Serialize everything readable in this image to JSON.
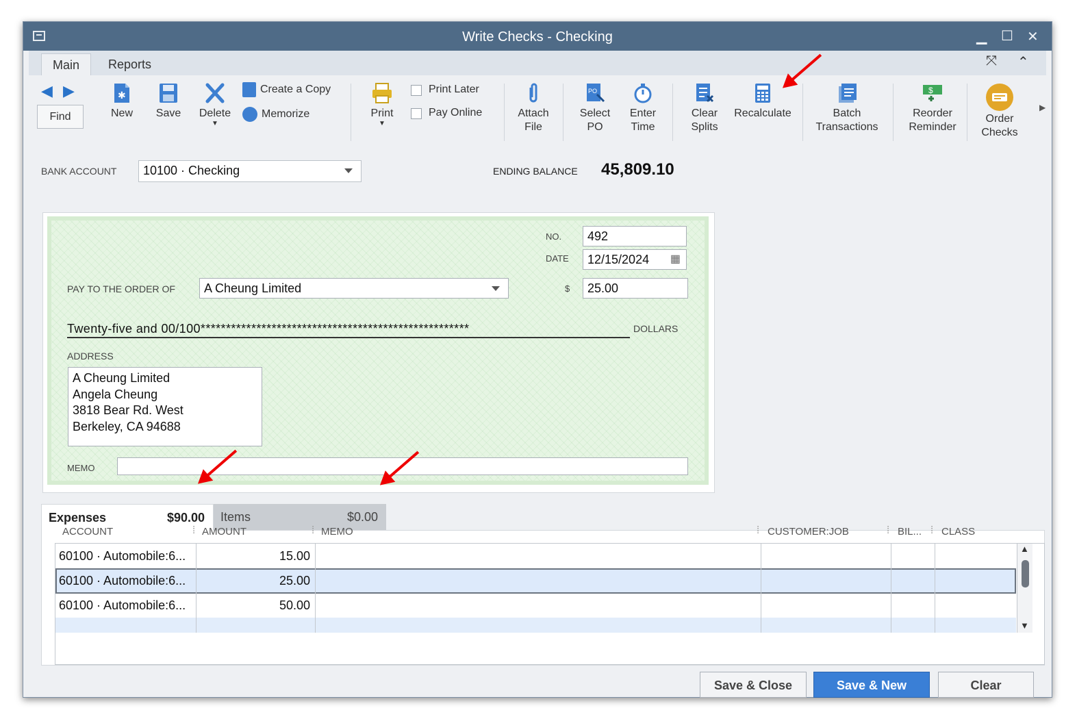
{
  "window": {
    "title": "Write Checks - Checking"
  },
  "tabs": [
    {
      "label": "Main"
    },
    {
      "label": "Reports"
    }
  ],
  "toolbar": {
    "find": "Find",
    "new": "New",
    "save": "Save",
    "delete": "Delete",
    "create_copy": "Create a Copy",
    "memorize": "Memorize",
    "print": "Print",
    "print_later": "Print Later",
    "pay_online": "Pay Online",
    "attach_1": "Attach",
    "attach_2": "File",
    "select_1": "Select",
    "select_2": "PO",
    "enter_1": "Enter",
    "enter_2": "Time",
    "clear_1": "Clear",
    "clear_2": "Splits",
    "recalculate": "Recalculate",
    "batch_1": "Batch",
    "batch_2": "Transactions",
    "reorder_1": "Reorder",
    "reorder_2": "Reminder",
    "order_1": "Order",
    "order_2": "Checks"
  },
  "bank": {
    "label": "BANK ACCOUNT",
    "value": "10100 · Checking",
    "ending_label": "ENDING BALANCE",
    "ending_value": "45,809.10"
  },
  "check": {
    "no_label": "NO.",
    "no": "492",
    "date_label": "DATE",
    "date": "12/15/2024",
    "payto_label": "PAY TO THE ORDER OF",
    "payee": "A Cheung Limited",
    "amount_label": "$",
    "amount": "25.00",
    "words": "Twenty-five and 00/100*****************************************************",
    "dollars": "DOLLARS",
    "address_label": "ADDRESS",
    "address": [
      "A Cheung Limited",
      "Angela Cheung",
      "3818 Bear Rd. West",
      "Berkeley, CA 94688"
    ],
    "memo_label": "MEMO"
  },
  "splits": {
    "expenses_label": "Expenses",
    "expenses_total": "$90.00",
    "items_label": "Items",
    "items_total": "$0.00",
    "columns": [
      "ACCOUNT",
      "AMOUNT",
      "MEMO",
      "CUSTOMER:JOB",
      "BIL...",
      "CLASS"
    ],
    "rows": [
      {
        "account": "60100 · Automobile:6...",
        "amount": "15.00"
      },
      {
        "account": "60100 · Automobile:6...",
        "amount": "25.00"
      },
      {
        "account": "60100 · Automobile:6...",
        "amount": "50.00"
      }
    ]
  },
  "buttons": {
    "save_close": "Save & Close",
    "save_new": "Save & New",
    "clear": "Clear"
  },
  "colors": {
    "titlebar": "#4f6b87",
    "check_bg": "#e6f5e3",
    "primary": "#3a7fd6",
    "annotation": "#e00000"
  }
}
